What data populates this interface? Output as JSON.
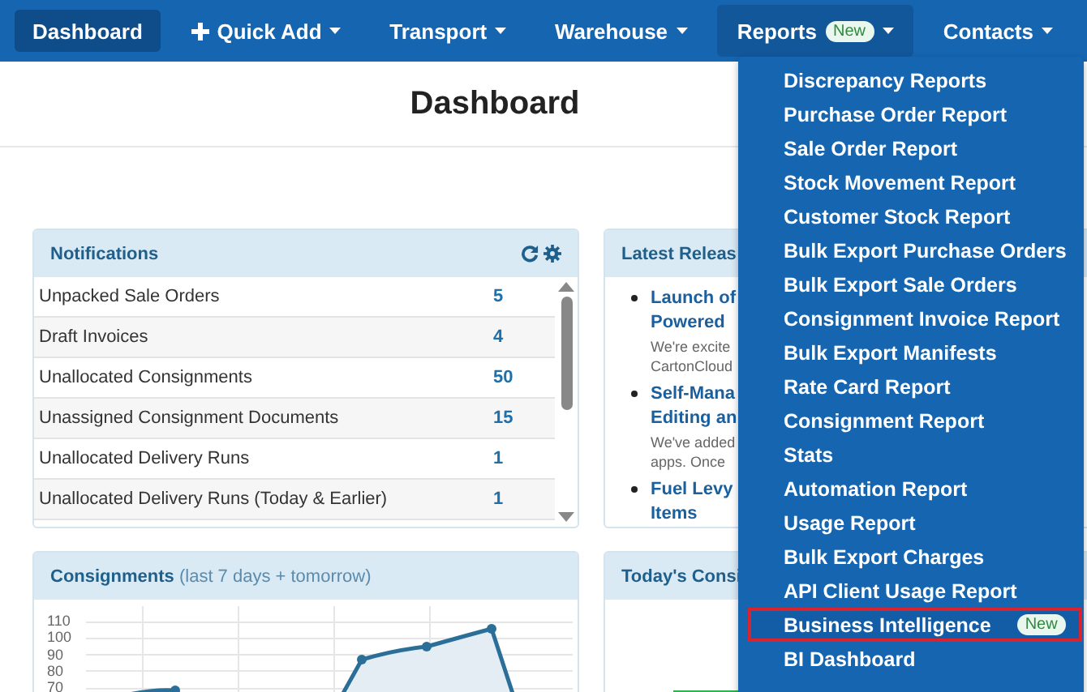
{
  "nav": [
    {
      "label": "Dashboard",
      "selected": true,
      "kind": "plain",
      "caret": false
    },
    {
      "label": "Quick Add",
      "selected": false,
      "kind": "plus",
      "caret": true
    },
    {
      "label": "Transport",
      "selected": false,
      "kind": "plain",
      "caret": true
    },
    {
      "label": "Warehouse",
      "selected": false,
      "kind": "plain",
      "caret": true
    },
    {
      "label": "Reports",
      "selected": false,
      "kind": "plain",
      "caret": true,
      "badge": "New",
      "open": true
    },
    {
      "label": "Contacts",
      "selected": false,
      "kind": "plain",
      "caret": true
    }
  ],
  "page_title": "Dashboard",
  "notifications": {
    "title": "Notifications",
    "rows": [
      {
        "label": "Unpacked Sale Orders",
        "count": "5"
      },
      {
        "label": "Draft Invoices",
        "count": "4"
      },
      {
        "label": "Unallocated Consignments",
        "count": "50"
      },
      {
        "label": "Unassigned Consignment Documents",
        "count": "15"
      },
      {
        "label": "Unallocated Delivery Runs",
        "count": "1"
      },
      {
        "label": "Unallocated Delivery Runs (Today & Earlier)",
        "count": "1"
      }
    ]
  },
  "releases": {
    "title": "Latest Releas",
    "items": [
      {
        "title_lines": [
          "Launch of",
          "Powered"
        ],
        "summary_lines": [
          "We're excite",
          "CartonCloud"
        ]
      },
      {
        "title_lines": [
          "Self-Mana",
          "Editing an"
        ],
        "summary_lines": [
          "We've added",
          "apps. Once"
        ]
      },
      {
        "title_lines": [
          "Fuel Levy",
          "Items"
        ]
      }
    ]
  },
  "consignments": {
    "title": "Consignments",
    "subtitle": "(last 7 days + tomorrow)",
    "y_labels": [
      "110",
      "100",
      "90",
      "80",
      "70"
    ]
  },
  "today": {
    "title": "Today's Consi"
  },
  "reports_menu": [
    {
      "label": "Discrepancy Reports",
      "highlighted": false
    },
    {
      "label": "Purchase Order Report",
      "highlighted": false
    },
    {
      "label": "Sale Order Report",
      "highlighted": false
    },
    {
      "label": "Stock Movement Report",
      "highlighted": false
    },
    {
      "label": "Customer Stock Report",
      "highlighted": false
    },
    {
      "label": "Bulk Export Purchase Orders",
      "highlighted": false
    },
    {
      "label": "Bulk Export Sale Orders",
      "highlighted": false
    },
    {
      "label": "Consignment Invoice Report",
      "highlighted": false
    },
    {
      "label": "Bulk Export Manifests",
      "highlighted": false
    },
    {
      "label": "Rate Card Report",
      "highlighted": false
    },
    {
      "label": "Consignment Report",
      "highlighted": false
    },
    {
      "label": "Stats",
      "highlighted": false
    },
    {
      "label": "Automation Report",
      "highlighted": false
    },
    {
      "label": "Usage Report",
      "highlighted": false
    },
    {
      "label": "Bulk Export Charges",
      "highlighted": false
    },
    {
      "label": "API Client Usage Report",
      "highlighted": false
    },
    {
      "label": "Business Intelligence",
      "highlighted": true,
      "badge": "New"
    },
    {
      "label": "BI Dashboard",
      "highlighted": false
    }
  ]
}
